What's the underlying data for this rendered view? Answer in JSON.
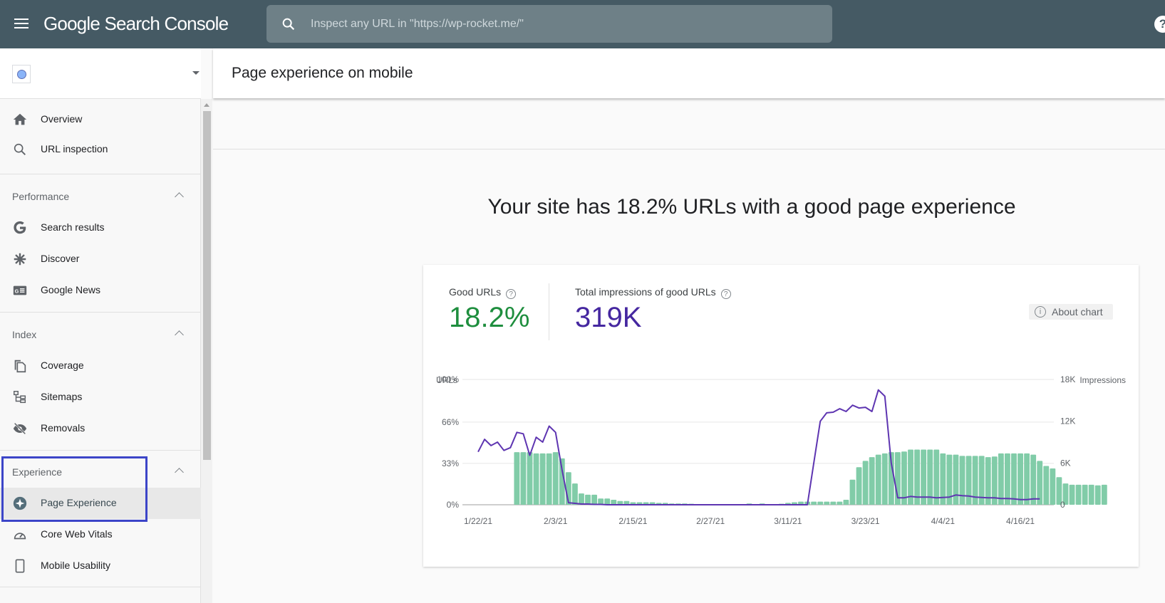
{
  "app": {
    "title": "Google Search Console",
    "search_placeholder": "Inspect any URL in \"https://wp-rocket.me/\"",
    "help_glyph": "?"
  },
  "sidebar": {
    "top_items": [
      {
        "label": "Overview",
        "icon": "home-icon"
      },
      {
        "label": "URL inspection",
        "icon": "search-icon"
      }
    ],
    "sections": [
      {
        "title": "Performance",
        "items": [
          {
            "label": "Search results",
            "icon": "google-g-icon"
          },
          {
            "label": "Discover",
            "icon": "asterisk-icon"
          },
          {
            "label": "Google News",
            "icon": "google-news-icon"
          }
        ]
      },
      {
        "title": "Index",
        "items": [
          {
            "label": "Coverage",
            "icon": "copy-icon"
          },
          {
            "label": "Sitemaps",
            "icon": "sitemap-icon"
          },
          {
            "label": "Removals",
            "icon": "eye-off-icon"
          }
        ]
      },
      {
        "title": "Experience",
        "items": [
          {
            "label": "Page Experience",
            "icon": "page-experience-icon",
            "active": true
          },
          {
            "label": "Core Web Vitals",
            "icon": "gauge-icon"
          },
          {
            "label": "Mobile Usability",
            "icon": "phone-icon"
          }
        ]
      }
    ]
  },
  "main": {
    "page_title": "Page experience on mobile",
    "headline": "Your site has 18.2% URLs with a good page experience",
    "metrics": [
      {
        "label": "Good URLs",
        "value": "18.2%",
        "color": "#1e8e3e"
      },
      {
        "label": "Total impressions of good URLs",
        "value": "319K",
        "color": "#4527a0"
      }
    ],
    "about_chart_label": "About chart"
  },
  "chart_data": {
    "type": "bar",
    "title": "",
    "left_axis_label": "URLs",
    "right_axis_label": "Impressions",
    "left_ticks": [
      "0%",
      "33%",
      "66%",
      "100%"
    ],
    "left_tick_values": [
      0,
      33,
      66,
      100
    ],
    "right_ticks": [
      "0",
      "6K",
      "12K",
      "18K"
    ],
    "right_tick_values": [
      0,
      6000,
      12000,
      18000
    ],
    "ylim_left": [
      0,
      100
    ],
    "ylim_right": [
      0,
      18000
    ],
    "x_tick_labels": [
      "1/22/21",
      "2/3/21",
      "2/15/21",
      "2/27/21",
      "3/11/21",
      "3/23/21",
      "4/4/21",
      "4/16/21"
    ],
    "start_date": "1/22/21",
    "bar_color": "#81cca8",
    "line_color": "#5e35b1",
    "series": [
      {
        "name": "Good URLs (%)",
        "type": "bar",
        "axis": "left",
        "start_day_offset": 6,
        "values": [
          42,
          42,
          42,
          41,
          41,
          41,
          42,
          37,
          26,
          17,
          9,
          8,
          8,
          5,
          5,
          4,
          3,
          3,
          2,
          2,
          2,
          2,
          1.5,
          1.5,
          1,
          1,
          1,
          0.8,
          0.5,
          0.5,
          0.5,
          0.5,
          0.5,
          0.5,
          0.5,
          0.5,
          1,
          0.5,
          1,
          0.5,
          0.5,
          0.8,
          1.5,
          2,
          2.5,
          2.5,
          2.5,
          2.5,
          2.5,
          2.5,
          2.5,
          4,
          20,
          30,
          35,
          38,
          40,
          41,
          42,
          42,
          42.5,
          44,
          44,
          44,
          44,
          44,
          41,
          40,
          40,
          39,
          39,
          39,
          39,
          38,
          38.5,
          41,
          41,
          41,
          41,
          41,
          40,
          35,
          31,
          29,
          22,
          17,
          16,
          16,
          16,
          16,
          15.5,
          16
        ]
      },
      {
        "name": "Impressions",
        "type": "line",
        "axis": "right",
        "start_day_offset": 0,
        "values": [
          7600,
          9400,
          8500,
          9000,
          7800,
          8200,
          10400,
          10200,
          7100,
          9700,
          9000,
          11300,
          10400,
          5000,
          300,
          200,
          100,
          100,
          50,
          50,
          0,
          0,
          0,
          0,
          0,
          0,
          0,
          0,
          0,
          0,
          0,
          0,
          0,
          0,
          0,
          0,
          0,
          0,
          0,
          0,
          0,
          0,
          0,
          0,
          0,
          0,
          0,
          0,
          0,
          0,
          0,
          0,
          6000,
          12000,
          13200,
          13300,
          13800,
          13400,
          14300,
          13900,
          14000,
          13400,
          16500,
          15600,
          6000,
          1000,
          1000,
          1200,
          1100,
          1100,
          1100,
          1000,
          1050,
          1100,
          1400,
          1300,
          1250,
          1100,
          1050,
          1000,
          1000,
          900,
          900,
          850,
          750,
          750,
          850,
          850
        ]
      }
    ],
    "grid": true,
    "legend": "none"
  }
}
